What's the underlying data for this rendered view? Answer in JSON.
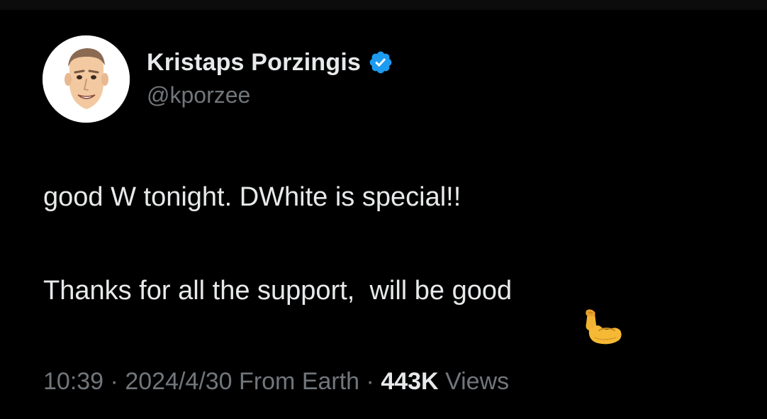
{
  "author": {
    "display_name": "Kristaps Porzingis",
    "handle": "@kporzee",
    "verified": true,
    "avatar_icon": "cartoon-face-avatar"
  },
  "tweet": {
    "line1": "good W tonight. DWhite is special!!",
    "line2": "Thanks for all the support,  will be good",
    "emoji_icon": "flexed-biceps-icon"
  },
  "meta": {
    "time": "10:39",
    "date": "2024/4/30",
    "source": "From Earth",
    "separator": "·",
    "views_count": "443K",
    "views_label": "Views"
  },
  "colors": {
    "background": "#000000",
    "text_primary": "#e7e9ea",
    "text_secondary": "#71767b",
    "verified_blue": "#1d9bf0"
  }
}
